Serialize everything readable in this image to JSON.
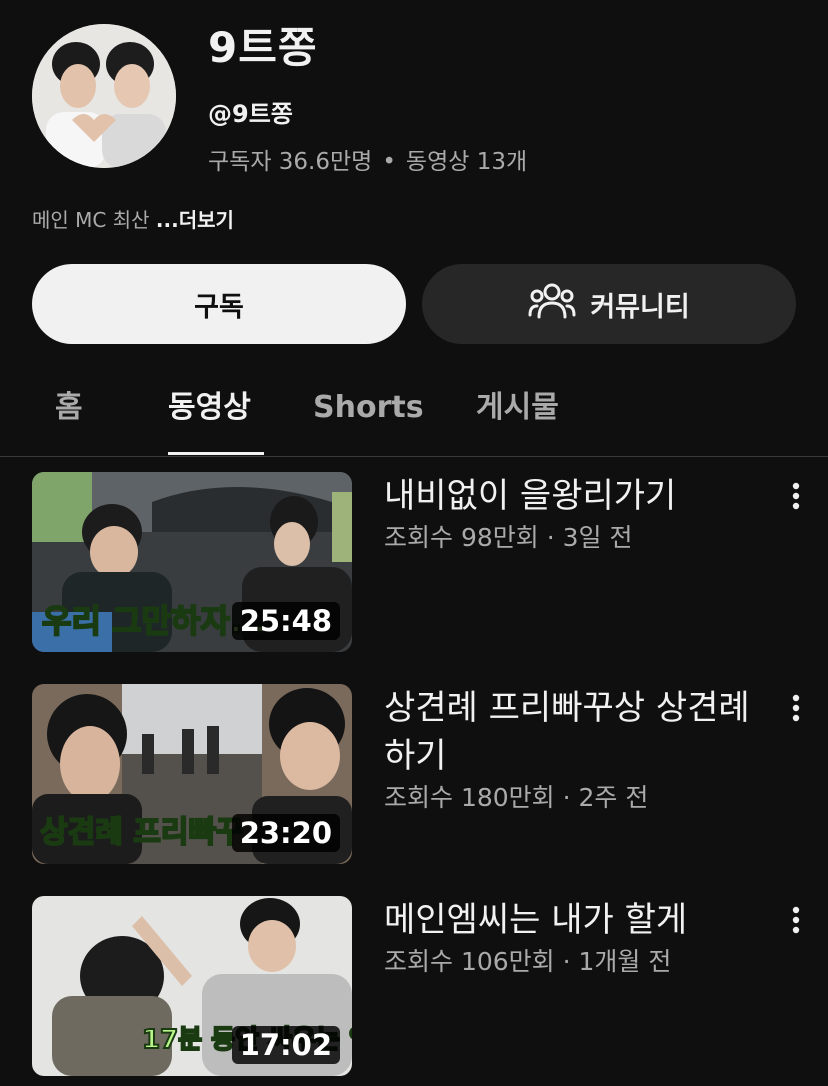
{
  "channel": {
    "name": "9트쫑",
    "handle": "@9트쫑",
    "subscribers": "구독자 36.6만명",
    "separator": "•",
    "video_count": "동영상 13개",
    "description": "메인 MC 최산 ",
    "more_label": "...더보기"
  },
  "buttons": {
    "subscribe_label": "구독",
    "community_label": "커뮤니티"
  },
  "tabs": [
    {
      "label": "홈",
      "active": false
    },
    {
      "label": "동영상",
      "active": true
    },
    {
      "label": "Shorts",
      "active": false
    },
    {
      "label": "게시물",
      "active": false
    }
  ],
  "videos": [
    {
      "title": "내비없이 을왕리가기",
      "meta": "조회수 98만회 · 3일 전",
      "duration": "25:48",
      "overlay_text": "우리 그만하자..."
    },
    {
      "title": "상견례 프리빠꾸상 상견례 하기",
      "meta": "조회수 180만회 · 2주 전",
      "duration": "23:20",
      "overlay_text": "상견례 프리빠꾸"
    },
    {
      "title": "메인엠씨는 내가 할게",
      "meta": "조회수 106만회 · 1개월 전",
      "duration": "17:02",
      "overlay_text": "17분 동안 싸우는 영상"
    }
  ],
  "icons": {
    "community": "people-icon",
    "more": "more-vertical-icon"
  },
  "colors": {
    "background": "#0f0f0f",
    "subscribe_bg": "#f1f1f1",
    "community_bg": "#272727",
    "secondary_text": "#aaaaaa",
    "thumbnail_caption": "#b8f58a"
  }
}
